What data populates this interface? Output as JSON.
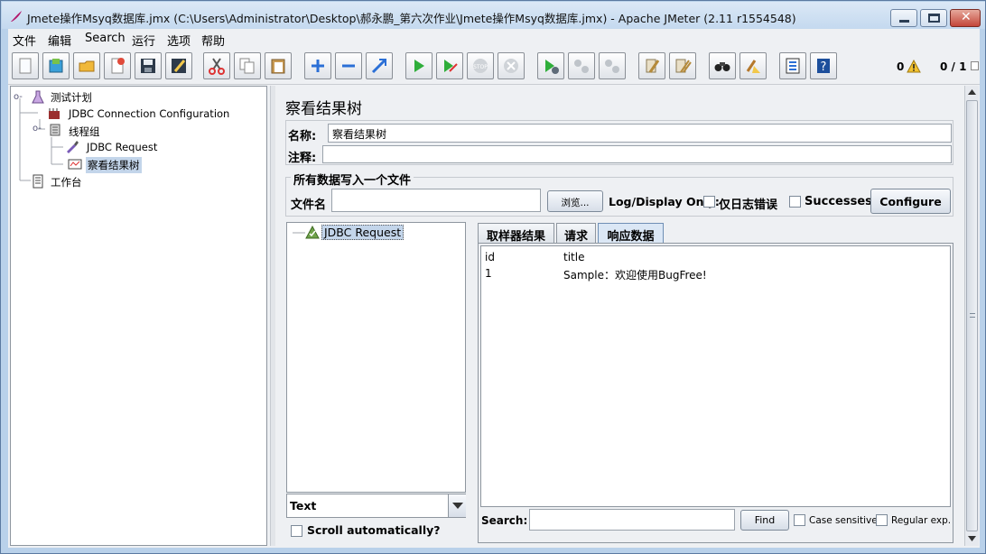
{
  "window": {
    "title": "Jmete操作Msyq数据库.jmx (C:\\Users\\Administrator\\Desktop\\郝永鹏_第六次作业\\Jmete操作Msyq数据库.jmx) - Apache JMeter (2.11 r1554548)"
  },
  "menu": [
    "文件",
    "编辑",
    "Search",
    "运行",
    "选项",
    "帮助"
  ],
  "toolbar": {
    "icons": [
      "new-icon",
      "templates-icon",
      "open-icon",
      "close-icon",
      "save-icon",
      "save-as-icon",
      "cut-icon",
      "copy-icon",
      "paste-icon",
      "expand-icon",
      "collapse-icon",
      "toggle-icon",
      "start-icon",
      "start-no-pause-icon",
      "stop-icon",
      "shutdown-icon",
      "remote-start-icon",
      "remote-stop-icon",
      "remote-shutdown-icon",
      "clear-icon",
      "clear-all-icon",
      "search-icon",
      "reset-search-icon",
      "function-helper-icon",
      "help-icon"
    ],
    "warning_count": "0",
    "threads": "0 / 1"
  },
  "tree": {
    "items": [
      {
        "label": "测试计划"
      },
      {
        "label": "JDBC Connection Configuration"
      },
      {
        "label": "线程组"
      },
      {
        "label": "JDBC Request"
      },
      {
        "label": "察看结果树"
      },
      {
        "label": "工作台"
      }
    ]
  },
  "main": {
    "heading": "察看结果树",
    "name_label": "名称:",
    "name_value": "察看结果树",
    "comment_label": "注释:",
    "comment_value": "",
    "file_section_title": "所有数据写入一个文件",
    "filename_label": "文件名",
    "filename_value": "",
    "browse_label": "浏览...",
    "log_display_label": "Log/Display Only:",
    "errors_label": "仅日志错误",
    "successes_label": "Successes",
    "configure_label": "Configure"
  },
  "results": {
    "tree_node": "JDBC Request",
    "renderer": "Text",
    "scroll_auto_label": "Scroll automatically?",
    "tabs": [
      "取样器结果",
      "请求",
      "响应数据"
    ],
    "active_tab": 2,
    "response_header": [
      "id",
      "title"
    ],
    "response_row": [
      "1",
      "Sample：欢迎使用BugFree!"
    ],
    "search_label": "Search:",
    "search_value": "",
    "find_label": "Find",
    "case_sensitive_label": "Case sensitive",
    "regex_label": "Regular exp."
  },
  "colors": {
    "selection": "#c3d5ea",
    "accent": "#2b6fd6"
  }
}
